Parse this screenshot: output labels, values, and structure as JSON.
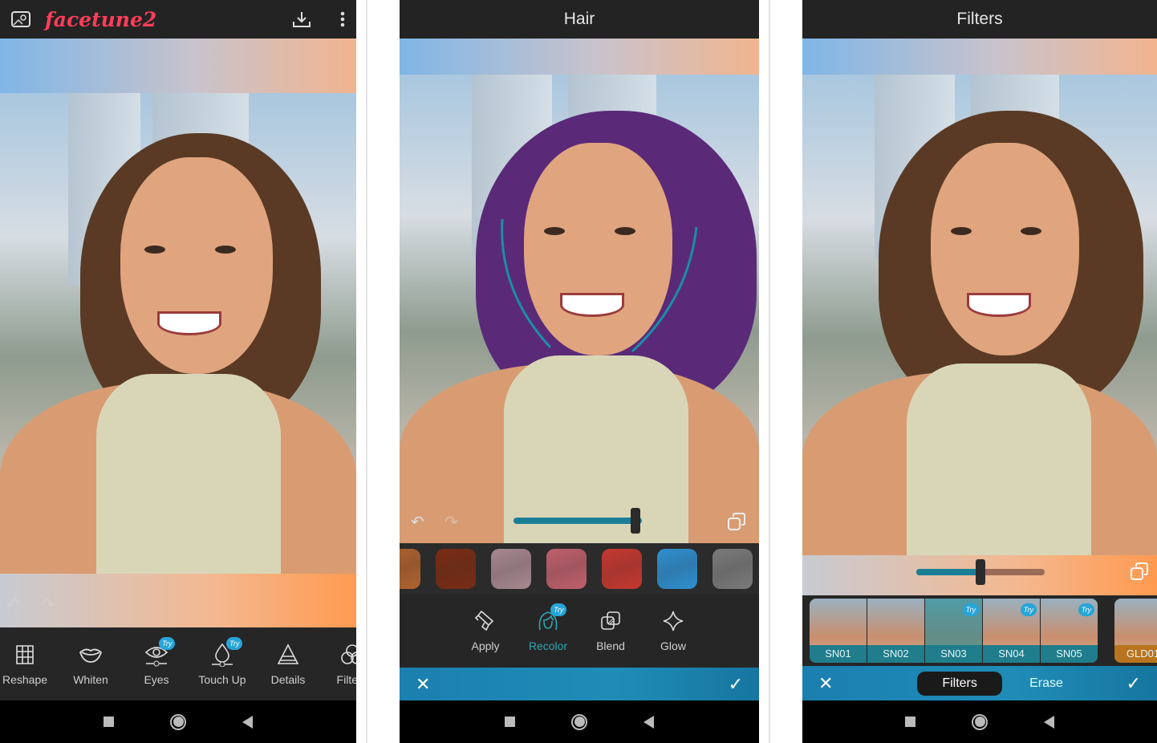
{
  "panel1": {
    "logo": "facetune2",
    "tools": [
      {
        "label": "Reshape",
        "icon": "grid-icon"
      },
      {
        "label": "Whiten",
        "icon": "lips-icon"
      },
      {
        "label": "Eyes",
        "icon": "eye-icon",
        "badge": "Try"
      },
      {
        "label": "Touch Up",
        "icon": "drop-icon",
        "badge": "Try"
      },
      {
        "label": "Details",
        "icon": "triangle-icon"
      },
      {
        "label": "Filte",
        "icon": "filters-icon"
      }
    ]
  },
  "panel2": {
    "title": "Hair",
    "slider_value": 0.95,
    "swatches": [
      "#b0622e",
      "#7a2c14",
      "#a88890",
      "#c0606c",
      "#c63830",
      "#2f8fd0",
      "#7a7a7a"
    ],
    "tools": [
      {
        "label": "Apply",
        "icon": "brush-icon"
      },
      {
        "label": "Recolor",
        "icon": "hair-icon",
        "badge": "Try",
        "active": true
      },
      {
        "label": "Blend",
        "icon": "blend-icon"
      },
      {
        "label": "Glow",
        "icon": "sparkle-icon"
      }
    ],
    "accent": "#2aa7b4"
  },
  "panel3": {
    "title": "Filters",
    "slider_value": 0.5,
    "filters": [
      {
        "label": "SN01"
      },
      {
        "label": "SN02"
      },
      {
        "label": "SN03",
        "badge": "Try",
        "selected": true
      },
      {
        "label": "SN04",
        "badge": "Try"
      },
      {
        "label": "SN05",
        "badge": "Try"
      },
      {
        "label": "GLD01"
      }
    ],
    "tabs": [
      {
        "label": "Filters",
        "active": true
      },
      {
        "label": "Erase"
      }
    ]
  }
}
